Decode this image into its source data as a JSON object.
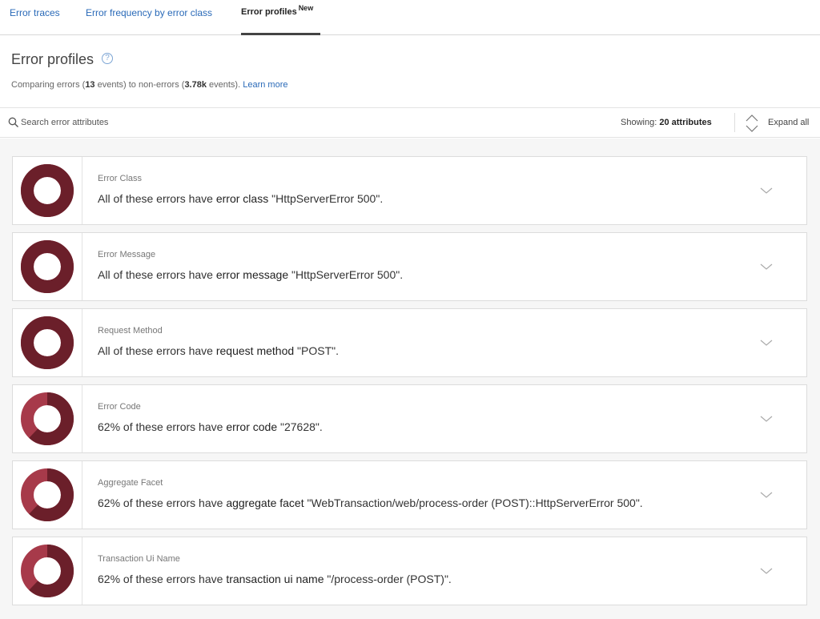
{
  "tabs": [
    {
      "label": "Error traces",
      "active": false
    },
    {
      "label": "Error frequency by error class",
      "active": false
    },
    {
      "label": "Error profiles",
      "badge": "New",
      "active": true
    }
  ],
  "header": {
    "title": "Error profiles",
    "help_icon": "question-circle-icon",
    "subtitle": {
      "prefix": "Comparing errors (",
      "errors_count": "13",
      "middle": " events) to non-errors (",
      "non_errors_count": "3.78k",
      "suffix": " events).",
      "link": "Learn more"
    }
  },
  "toolbar": {
    "search_placeholder": "Search error attributes",
    "showing_label": "Showing:",
    "showing_value": "20 attributes",
    "expand_label": "Expand all"
  },
  "colors": {
    "donut_primary": "#6b1f2a",
    "donut_secondary": "#a73a4a",
    "link": "#2a6ab8"
  },
  "attributes": [
    {
      "label": "Error Class",
      "prefix": "All of these errors have",
      "attribute": "error class",
      "value": "\"HttpServerError 500\".",
      "share": 1.0
    },
    {
      "label": "Error Message",
      "prefix": "All of these errors have",
      "attribute": "error message",
      "value": "\"HttpServerError 500\".",
      "share": 1.0
    },
    {
      "label": "Request Method",
      "prefix": "All of these errors have",
      "attribute": "request method",
      "value": "\"POST\".",
      "share": 1.0
    },
    {
      "label": "Error Code",
      "prefix": "62% of these errors have",
      "attribute": "error code",
      "value": "\"27628\".",
      "share": 0.62
    },
    {
      "label": "Aggregate Facet",
      "prefix": "62% of these errors have",
      "attribute": "aggregate facet",
      "value": "\"WebTransaction/web/process-order (POST)::HttpServerError 500\".",
      "share": 0.62
    },
    {
      "label": "Transaction Ui Name",
      "prefix": "62% of these errors have",
      "attribute": "transaction ui name",
      "value": "\"/process-order (POST)\".",
      "share": 0.62
    }
  ]
}
